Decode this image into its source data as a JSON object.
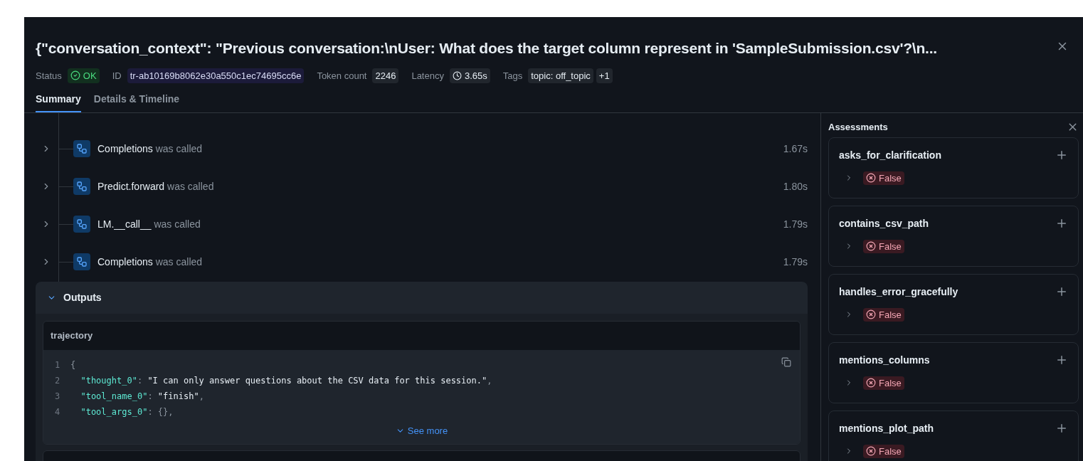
{
  "header": {
    "title": "{\"conversation_context\": \"Previous conversation:\\nUser: What does the target column represent in 'SampleSubmission.csv'?\\n...",
    "meta": [
      {
        "kind": "status",
        "label": "Status",
        "value": "OK"
      },
      {
        "kind": "id",
        "label": "ID",
        "value": "tr-ab10169b8062e30a550c1ec74695cc6e"
      },
      {
        "kind": "plain",
        "label": "Token count",
        "value": "2246"
      },
      {
        "kind": "latency",
        "label": "Latency",
        "value": "3.65s"
      },
      {
        "kind": "tags",
        "label": "Tags",
        "values": [
          "topic: off_topic",
          "+1"
        ]
      }
    ]
  },
  "tabs": [
    {
      "label": "Summary",
      "selected": true
    },
    {
      "label": "Details & Timeline",
      "selected": false
    }
  ],
  "spans": [
    {
      "name": "Completions",
      "suffix": "was called",
      "duration": "1.67s",
      "expanded": false
    },
    {
      "name": "Predict.forward",
      "suffix": "was called",
      "duration": "1.80s",
      "expanded": false
    },
    {
      "name": "LM.__call__",
      "suffix": "was called",
      "duration": "1.79s",
      "expanded": false
    },
    {
      "name": "Completions",
      "suffix": "was called",
      "duration": "1.79s",
      "expanded": false
    }
  ],
  "outputs": {
    "title": "Outputs",
    "expanded": true,
    "field": "trajectory",
    "lines": [
      {
        "number": "1",
        "tokens": [
          {
            "kind": "punct",
            "text": "{"
          }
        ]
      },
      {
        "number": "2",
        "tokens": [
          {
            "kind": "key",
            "text": "  \"thought_0\""
          },
          {
            "kind": "punct",
            "text": ": "
          },
          {
            "kind": "string",
            "text": "\"I can only answer questions about the CSV data for this session.\""
          },
          {
            "kind": "punct",
            "text": ","
          }
        ]
      },
      {
        "number": "3",
        "tokens": [
          {
            "kind": "key",
            "text": "  \"tool_name_0\""
          },
          {
            "kind": "punct",
            "text": ": "
          },
          {
            "kind": "string",
            "text": "\"finish\""
          },
          {
            "kind": "punct",
            "text": ","
          }
        ]
      },
      {
        "number": "4",
        "tokens": [
          {
            "kind": "key",
            "text": "  \"tool_args_0\""
          },
          {
            "kind": "punct",
            "text": ": {},"
          }
        ]
      }
    ],
    "see_more": "See more"
  },
  "assessments": {
    "title": "Assessments",
    "items": [
      {
        "name": "asks_for_clarification",
        "value": "False",
        "passed": false
      },
      {
        "name": "contains_csv_path",
        "value": "False",
        "passed": false
      },
      {
        "name": "handles_error_gracefully",
        "value": "False",
        "passed": false
      },
      {
        "name": "mentions_columns",
        "value": "False",
        "passed": false
      },
      {
        "name": "mentions_plot_path",
        "value": "False",
        "passed": false
      }
    ]
  }
}
